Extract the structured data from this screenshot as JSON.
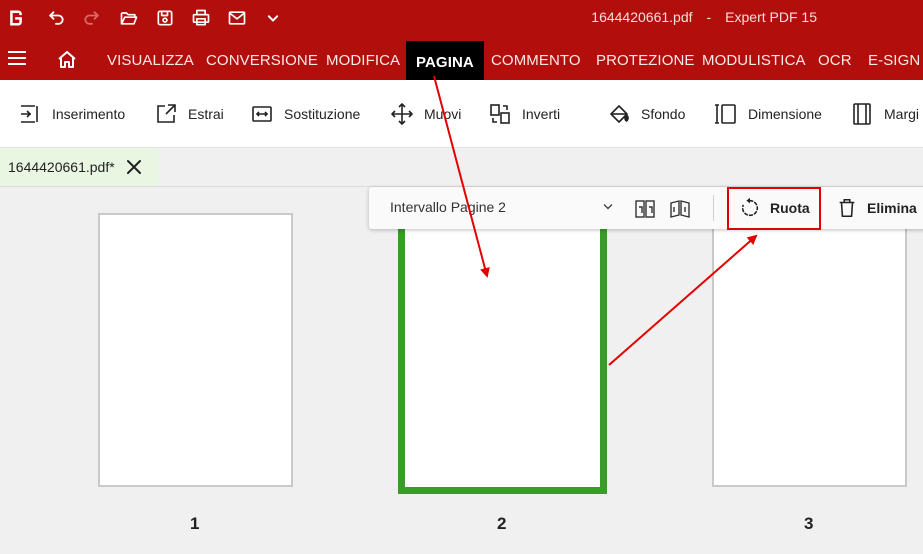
{
  "window": {
    "filename": "1644420661.pdf",
    "separator": "-",
    "app_name": "Expert PDF 15"
  },
  "quick_access": [
    "app-logo-icon",
    "undo-icon",
    "redo-icon",
    "open-folder-icon",
    "save-icon",
    "print-icon",
    "mail-icon",
    "chevron-down-icon"
  ],
  "menu": {
    "tabs": [
      "VISUALIZZA",
      "CONVERSIONE",
      "MODIFICA",
      "PAGINA",
      "COMMENTO",
      "PROTEZIONE",
      "MODULISTICA",
      "OCR",
      "E-SIGN"
    ],
    "active": "PAGINA"
  },
  "ribbon": {
    "items": [
      "Inserimento",
      "Estrai",
      "Sostituzione",
      "Muovi",
      "Inverti",
      "Sfondo",
      "Dimensione",
      "Margi"
    ]
  },
  "document_tab": {
    "label": "1644420661.pdf*"
  },
  "float_toolbar": {
    "range_label": "Intervallo Pagine 2",
    "rotate_label": "Ruota",
    "delete_label": "Elimina"
  },
  "pages": [
    {
      "number": "1"
    },
    {
      "number": "2"
    },
    {
      "number": "3"
    }
  ],
  "colors": {
    "brand": "#b20e0b",
    "active_tab": "#000000",
    "selection": "#3a9a2a",
    "annotation": "#e30000"
  }
}
